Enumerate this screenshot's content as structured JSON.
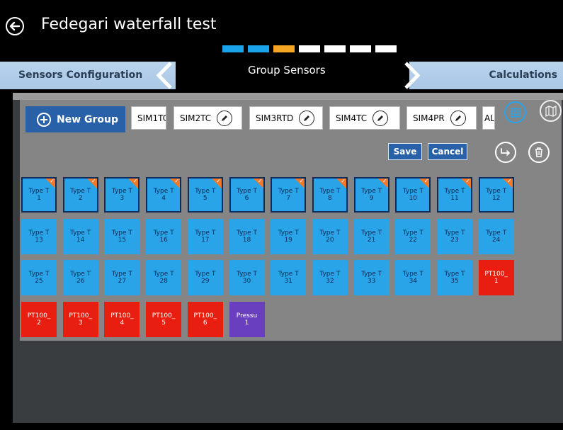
{
  "header": {
    "title": "Fedegari waterfall test"
  },
  "progress_steps": [
    {
      "color": "#1aa3e8"
    },
    {
      "color": "#1aa3e8"
    },
    {
      "color": "#f5a623"
    },
    {
      "color": "#ffffff"
    },
    {
      "color": "#ffffff"
    },
    {
      "color": "#ffffff"
    },
    {
      "color": "#ffffff"
    }
  ],
  "nav": {
    "left_label": "Sensors Configuration",
    "center_label": "Group Sensors",
    "right_label": "Calculations"
  },
  "toolbar": {
    "new_group_label": "New Group",
    "groups": [
      "SIM1TC",
      "SIM2TC",
      "SIM3RTD",
      "SIM4TC",
      "SIM4PR",
      "AL"
    ],
    "save_label": "Save",
    "cancel_label": "Cancel"
  },
  "tiles": [
    {
      "line1": "Type T",
      "line2": "1",
      "style": "sel"
    },
    {
      "line1": "Type T",
      "line2": "2",
      "style": "sel"
    },
    {
      "line1": "Type T",
      "line2": "3",
      "style": "sel"
    },
    {
      "line1": "Type T",
      "line2": "4",
      "style": "sel"
    },
    {
      "line1": "Type T",
      "line2": "5",
      "style": "sel"
    },
    {
      "line1": "Type T",
      "line2": "6",
      "style": "sel"
    },
    {
      "line1": "Type T",
      "line2": "7",
      "style": "sel"
    },
    {
      "line1": "Type T",
      "line2": "8",
      "style": "sel"
    },
    {
      "line1": "Type T",
      "line2": "9",
      "style": "sel"
    },
    {
      "line1": "Type T",
      "line2": "10",
      "style": "sel"
    },
    {
      "line1": "Type T",
      "line2": "11",
      "style": "sel"
    },
    {
      "line1": "Type T",
      "line2": "12",
      "style": "sel"
    },
    {
      "line1": "Type T",
      "line2": "13",
      "style": "blue"
    },
    {
      "line1": "Type T",
      "line2": "14",
      "style": "blue"
    },
    {
      "line1": "Type T",
      "line2": "15",
      "style": "blue"
    },
    {
      "line1": "Type T",
      "line2": "16",
      "style": "blue"
    },
    {
      "line1": "Type T",
      "line2": "17",
      "style": "blue"
    },
    {
      "line1": "Type T",
      "line2": "18",
      "style": "blue"
    },
    {
      "line1": "Type T",
      "line2": "19",
      "style": "blue"
    },
    {
      "line1": "Type T",
      "line2": "20",
      "style": "blue"
    },
    {
      "line1": "Type T",
      "line2": "21",
      "style": "blue"
    },
    {
      "line1": "Type T",
      "line2": "22",
      "style": "blue"
    },
    {
      "line1": "Type T",
      "line2": "23",
      "style": "blue"
    },
    {
      "line1": "Type T",
      "line2": "24",
      "style": "blue"
    },
    {
      "line1": "Type T",
      "line2": "25",
      "style": "blue"
    },
    {
      "line1": "Type T",
      "line2": "26",
      "style": "blue"
    },
    {
      "line1": "Type T",
      "line2": "27",
      "style": "blue"
    },
    {
      "line1": "Type T",
      "line2": "28",
      "style": "blue"
    },
    {
      "line1": "Type T",
      "line2": "29",
      "style": "blue"
    },
    {
      "line1": "Type T",
      "line2": "30",
      "style": "blue"
    },
    {
      "line1": "Type T",
      "line2": "31",
      "style": "blue"
    },
    {
      "line1": "Type T",
      "line2": "32",
      "style": "blue"
    },
    {
      "line1": "Type T",
      "line2": "33",
      "style": "blue"
    },
    {
      "line1": "Type T",
      "line2": "34",
      "style": "blue"
    },
    {
      "line1": "Type T",
      "line2": "35",
      "style": "blue"
    },
    {
      "line1": "PT100_",
      "line2": "1",
      "style": "red"
    },
    {
      "line1": "PT100_",
      "line2": "2",
      "style": "red"
    },
    {
      "line1": "PT100_",
      "line2": "3",
      "style": "red"
    },
    {
      "line1": "PT100_",
      "line2": "4",
      "style": "red"
    },
    {
      "line1": "PT100_",
      "line2": "5",
      "style": "red"
    },
    {
      "line1": "PT100_",
      "line2": "6",
      "style": "red"
    },
    {
      "line1": "Pressu",
      "line2": "1",
      "style": "purple"
    }
  ],
  "colors": {
    "accent_blue": "#2961a8",
    "tile_blue": "#2aa4e8",
    "tile_red": "#e81f10",
    "tile_purple": "#6a3fbf",
    "selection_badge": "#f07a2a"
  }
}
